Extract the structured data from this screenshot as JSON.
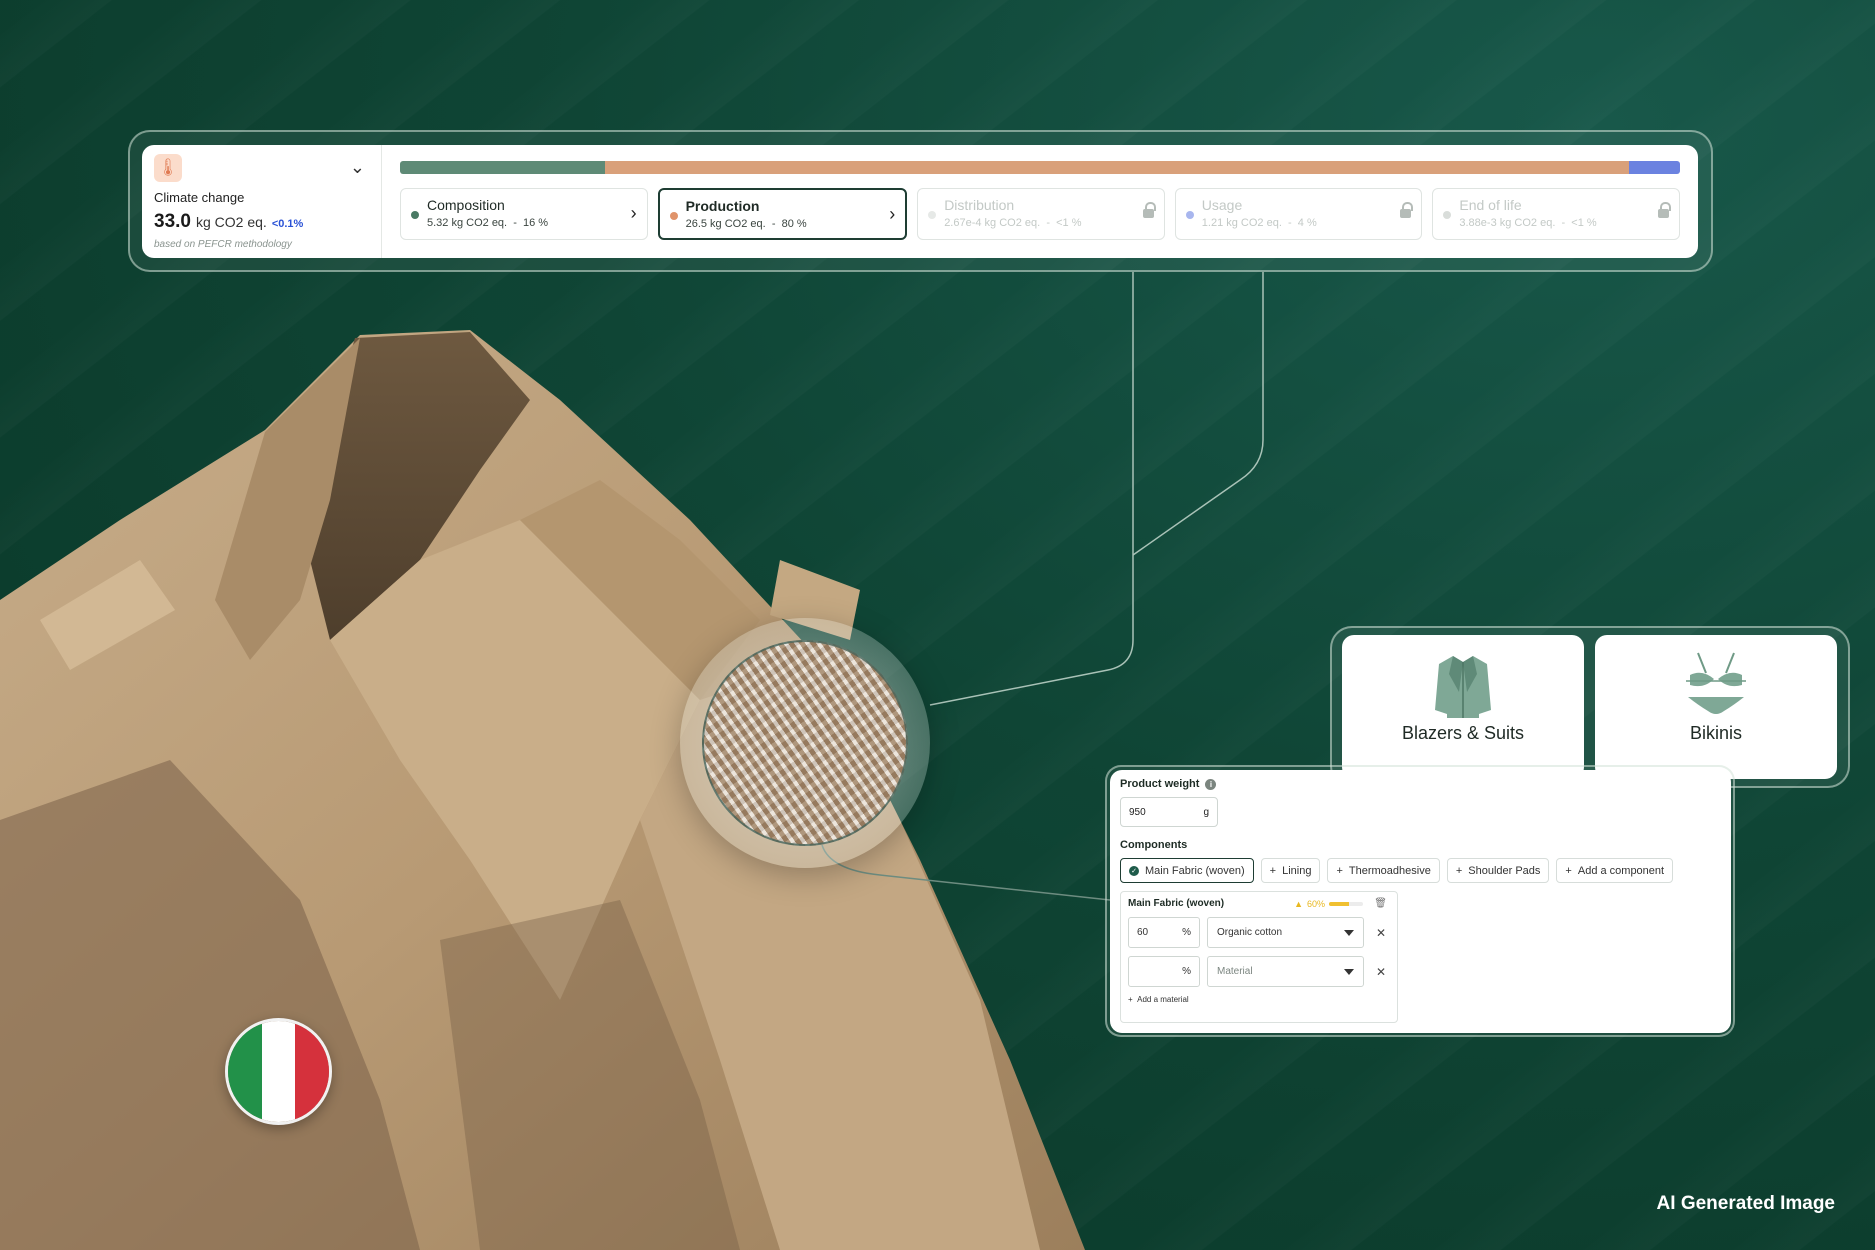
{
  "summary": {
    "indicator_label": "Climate change",
    "total_value": "33.0",
    "total_unit": "kg CO2 eq.",
    "delta": "<0.1%",
    "methodology": "based on PEFCR methodology",
    "icon": "thermometer-icon"
  },
  "impact_bar": {
    "segments": [
      {
        "stage": "Composition",
        "percent": 16,
        "color": "#5e8a76"
      },
      {
        "stage": "Production",
        "percent": 80,
        "color": "#d9a07a"
      },
      {
        "stage": "Usage",
        "percent": 4,
        "color": "#6b82e0"
      }
    ]
  },
  "stages": [
    {
      "name": "Composition",
      "value": "5.32 kg CO2 eq.",
      "share": "16 %",
      "dot_color": "#4a7a64",
      "state": "available"
    },
    {
      "name": "Production",
      "value": "26.5 kg CO2 eq.",
      "share": "80 %",
      "dot_color": "#e0936a",
      "state": "active"
    },
    {
      "name": "Distribution",
      "value": "2.67e-4 kg CO2 eq.",
      "share": "<1 %",
      "dot_color": "#e6e9e7",
      "state": "locked"
    },
    {
      "name": "Usage",
      "value": "1.21 kg CO2 eq.",
      "share": "4 %",
      "dot_color": "#a8b6ee",
      "state": "locked"
    },
    {
      "name": "End of life",
      "value": "3.88e-3 kg CO2 eq.",
      "share": "<1 %",
      "dot_color": "#d9ddda",
      "state": "locked"
    }
  ],
  "categories": [
    {
      "label": "Blazers & Suits",
      "icon": "blazer-icon"
    },
    {
      "label": "Bikinis",
      "icon": "bikini-icon"
    }
  ],
  "product_form": {
    "weight_label": "Product weight",
    "weight_value": "950",
    "weight_unit": "g",
    "components_label": "Components",
    "components": [
      "Main Fabric (woven)",
      "Lining",
      "Thermoadhesive",
      "Shoulder Pads"
    ],
    "add_component": "Add a component",
    "selected_component": {
      "title": "Main Fabric (woven)",
      "completion": "60%",
      "completion_fraction": 0.6,
      "rows": [
        {
          "percent": "60",
          "unit": "%",
          "material": "Organic cotton"
        },
        {
          "percent": "",
          "unit": "%",
          "material_placeholder": "Material"
        }
      ],
      "add_material": "Add a material"
    }
  },
  "colors": {
    "background": "#0f4535",
    "flag": [
      "#229149",
      "#ffffff",
      "#d5313c"
    ]
  },
  "watermark": "AI Generated Image"
}
